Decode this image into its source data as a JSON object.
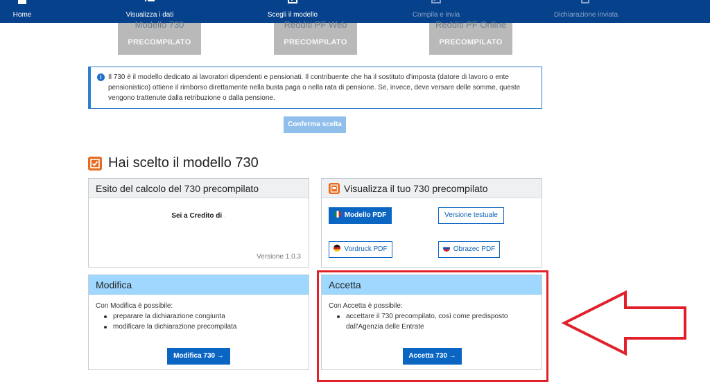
{
  "nav": {
    "items": [
      {
        "label": "Home",
        "icon": "home-icon",
        "state": "active"
      },
      {
        "label": "Visualizza i dati",
        "icon": "list-icon",
        "state": "active"
      },
      {
        "label": "Scegli il modello",
        "icon": "checkbox-icon",
        "state": "current"
      },
      {
        "label": "Compila e invia",
        "icon": "edit-icon",
        "state": "disabled"
      },
      {
        "label": "Dichiarazione inviata",
        "icon": "export-icon",
        "state": "disabled"
      }
    ],
    "background": "#06428b"
  },
  "models": [
    {
      "title": "Modello 730",
      "subtitle": "PRECOMPILATO"
    },
    {
      "title": "Redditi PF Web",
      "subtitle": "PRECOMPILATO"
    },
    {
      "title": "Redditi PF Online",
      "subtitle": "PRECOMPILATO"
    }
  ],
  "info": {
    "text": "Il 730 è il modello dedicato ai lavoratori dipendenti e pensionati. Il contribuente che ha il sostituto d'imposta (datore di lavoro o ente pensionistico) ottiene il rimborso direttamente nella busta paga o nella rata di pensione. Se, invece, deve versare delle somme, queste vengono trattenute dalla retribuzione o dalla pensione."
  },
  "confirm_label": "Conferma scelta",
  "section_title": "Hai scelto il modello 730",
  "esito": {
    "title": "Esito del calcolo del 730 precompilato",
    "credit_text": "Sei a Credito di",
    "credit_suffix": ".",
    "version": "Versione 1.0.3"
  },
  "visualizza": {
    "title": "Visualizza il tuo 730 precompilato",
    "buttons": {
      "modello_pdf": "Modello PDF",
      "versione_testuale": "Versione testuale",
      "vordruck_pdf": "Vordruck PDF",
      "obrazec_pdf": "Obrazec PDF"
    }
  },
  "modifica": {
    "title": "Modifica",
    "intro": "Con Modifica è possibile:",
    "items": [
      "preparare la dichiarazione congiunta",
      "modificare la dichiarazione precompilata"
    ],
    "button": "Modifica 730 →"
  },
  "accetta": {
    "title": "Accetta",
    "intro": "Con Accetta è possibile:",
    "items": [
      "accettare il 730 precompilato, così come predisposto dall'Agenzia delle Entrate"
    ],
    "button": "Accetta 730 →"
  },
  "colors": {
    "accent_orange": "#e86c20",
    "primary_blue": "#0b66c3",
    "highlight_red": "#e2202a"
  }
}
